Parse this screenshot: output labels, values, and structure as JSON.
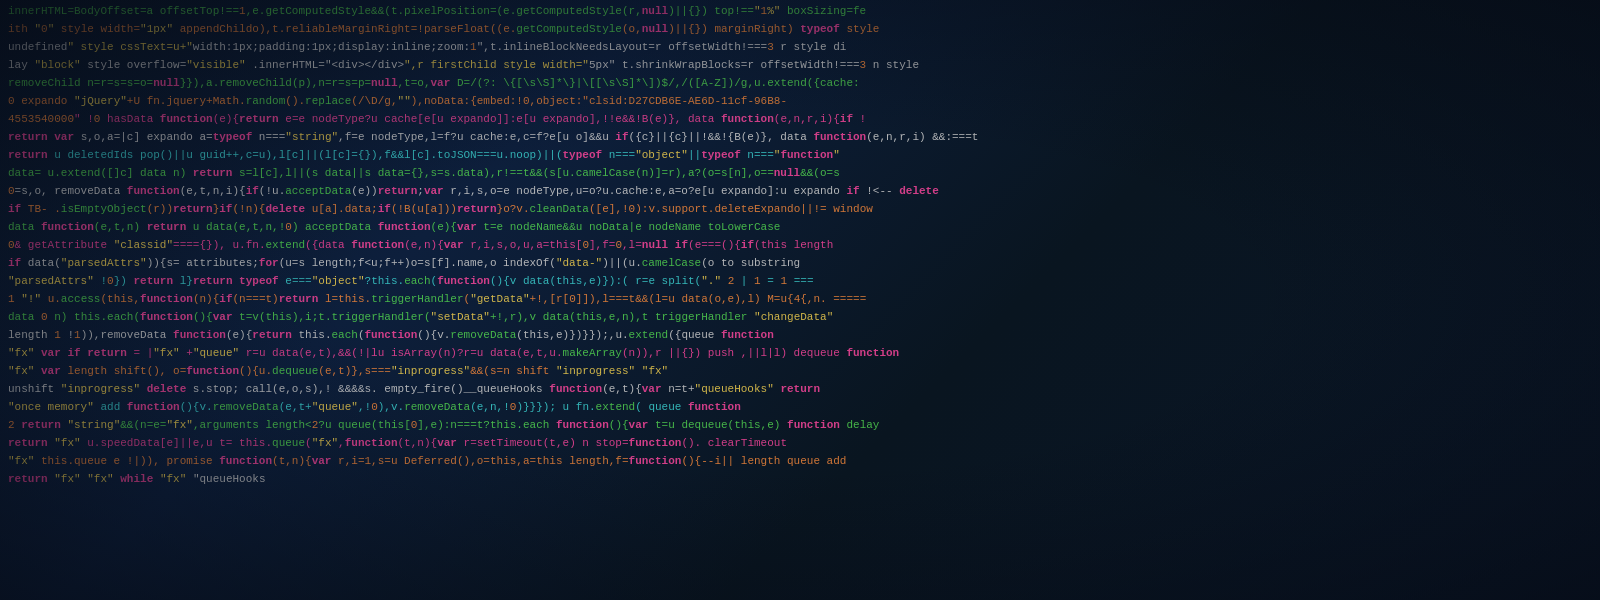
{
  "lines": [
    {
      "text": "          innerHTML=BodyOffset=a offsetTop!==1,e.getComputedStyle&&(t.pixelPosition=(e.getComputedStyle(r,null)||{}) top!==&quot;1%&quot; boxSizing=fe",
      "color": "c-green"
    },
    {
      "text": "  ith &quot;0&quot;  style width=&quot;1px&quot;   appendChildo),t.reliableMarginRight=!parseFloat((e.getComputedStyle(o,null)||{}) marginRight)  typeof  style",
      "color": "c-orange"
    },
    {
      "text": "undefined&quot;   style cssText=u+&quot;width:1px;padding:1px;display:inline;zoom:1&quot;,t.inlineBlockNeedsLayout=r offsetWidth!===3 r style di",
      "color": "c-white"
    },
    {
      "text": " lay &quot;block&quot;  style  overflow=&quot;visible&quot; .innerHTML=&quot;&lt;div&gt;&lt;/div&gt;&quot;,r firstChild style width=&quot;5px&quot; t.shrinkWrapBlocks=r offsetWidth!===3 n style",
      "color": "c-white"
    },
    {
      "text": " removeChild     n=r=s=s=o=null}}),a.removeChild(p),n=r=s=p=null,t=o,var D=/(?: \\{[\\s\\S]*\\}|\\[[\\s\\S]*\\])$/,/([A-Z])/g,u.extend({cache:",
      "color": "c-green"
    },
    {
      "text": "    0  expando  &quot;jQuery&quot;+U fn.jquery+Math.random().replace(/\\D/g,&quot;&quot;),noData:{embed:!0,object:&quot;clsid:D27CDB6E-AE6D-11cf-96B8-",
      "color": "c-orange"
    },
    {
      "text": " 4553540000&quot;  !0  hasData function(e){return e=e nodeType?u cache[e[u expando]]:e[u expando],!!e&&!B(e)}, data function(e,n,r,i){if !",
      "color": "c-pink"
    },
    {
      "text": "return var s,o,a=|c] expando a=typeof n===&quot;string&quot;,f=e nodeType,l=f?u cache:e,c=f?e[u o]&&u if({c}||{c}||!&&!{B(e)}, data function(e,n,r,i) &&:===t",
      "color": "c-white"
    },
    {
      "text": "  return u deletedIds pop()||u guid++,c=u),l[c]||(l[c]={}),f&&l[c].toJSON===u.noop)||(typeof n===&quot;object&quot;||typeof n===&quot;function&quot;",
      "color": "c-teal"
    },
    {
      "text": "    data= u.extend([]c]  data n) return s=l[c],l||(s data||s data={},s=s.data),r!==t&&(s[u.camelCase(n)]=r),a?(o=s[n],o==null&&(o=s",
      "color": "c-green"
    },
    {
      "text": " 0=s,o, removeData function(e,t,n,i){if(!u.acceptData(e))return;var r,i,s,o=e nodeType,u=o?u.cache:e,a=o?e[u expando]:u expando  if  !<-- delete",
      "color": "c-white"
    },
    {
      "text": " if   TB- .isEmptyObject(r))return}if(!n){delete u[a].data;if(!B(u[a]))return}o?v.cleanData([e],!0):v.support.deleteExpando||!=  window",
      "color": "c-orange"
    },
    {
      "text": "  data function(e,t,n) return u data(e,t,n,!0)  acceptData function(e){var t=e nodeName&&u noData|e nodeName toLowerCase",
      "color": "c-green"
    },
    {
      "text": "  0&  getAttribute &quot;classid&quot;===={}), u.fn.extend({data function(e,n){var r,i,s,o,u,a=this[0],f=0,l=null if(e===(){if(this length",
      "color": "c-pink"
    },
    {
      "text": " if    data(&quot;parsedAttrs&quot;)){s= attributes;for(u=s length;f&lt;u;f++)o=s[f].name,o indexOf(&quot;data-&quot;)||(u.camelCase(o to substring",
      "color": "c-white"
    },
    {
      "text": "   &quot;parsedAttrs&quot; !0}) return l}return typeof e===&quot;object&quot;?this.each(function(){v data(this,e)}):( r=e split(&quot;.&quot; 2 | 1 = 1  ===",
      "color": "c-teal"
    },
    {
      "text": " 1  &quot;!&quot;  u.access(this,function(n){if(n===t)return l=this.triggerHandler(&quot;getData&quot;+!,[r[0]]),l===t&&(l=u data(o,e),l)  M=u{4{,n.  =====",
      "color": "c-orange"
    },
    {
      "text": "  data 0  n) this.each(function(){var t=v(this),i;t.triggerHandler(&quot;setData&quot;+!,r),v data(this,e,n),t triggerHandler &quot;changeData&quot;",
      "color": "c-green"
    },
    {
      "text": "   length 1  !1)),removeData function(e){return this.each(function(){v.removeData(this,e)})}});,u.extend({queue function",
      "color": "c-white"
    },
    {
      "text": "&quot;fx&quot; var if  return  = |&quot;fx&quot; +&quot;queue&quot; r=u data(e,t),&&(!|lu isArray(n)?r=u data(e,t,u.makeArray(n)),r ||{})  push  ,||l|l) dequeue function",
      "color": "c-pink"
    },
    {
      "text": " &quot;fx&quot; var  length  shift(), o=function(){u.dequeue(e,t)},s===&quot;inprogress&quot;&&(s=n shift  &quot;inprogress&quot;  &quot;fx&quot;",
      "color": "c-orange"
    },
    {
      "text": " unshift  &quot;inprogress&quot;  delete s.stop; call(e,o,s),! &&&&s. empty_fire()__queueHooks function(e,t){var n=t+&quot;queueHooks&quot; return",
      "color": "c-white"
    },
    {
      "text": "   &quot;once memory&quot;  add function(){v.removeData(e,t+&quot;queue&quot;,!0),v.removeData(e,n,!0)}}}); u fn.extend( queue function",
      "color": "c-teal"
    },
    {
      "text": " 2 return  &quot;string&quot;&&(n=e=&quot;fx&quot;,arguments length&lt;2?u queue(this[0],e):n===t?this.each function(){var t=u  dequeue(this,e)  function  delay",
      "color": "c-green"
    },
    {
      "text": "  return  &quot;fx&quot;  u.speedData[e]||e,u t= this.queue(&quot;fx&quot;,function(t,n){var r=setTimeout(t,e)  n stop=function(). clearTimeout",
      "color": "c-pink"
    },
    {
      "text": "  &quot;fx&quot; this.queue  e  !|)),  promise function(t,n){var r,i=1,s=u  Deferred(),o=this,a=this length,f=function(){--i||  length  queue add",
      "color": "c-orange"
    },
    {
      "text": "     return  &quot;fx&quot;  &quot;fx&quot; while  &quot;fx&quot;  &quot;queueHooks",
      "color": "c-white"
    }
  ]
}
